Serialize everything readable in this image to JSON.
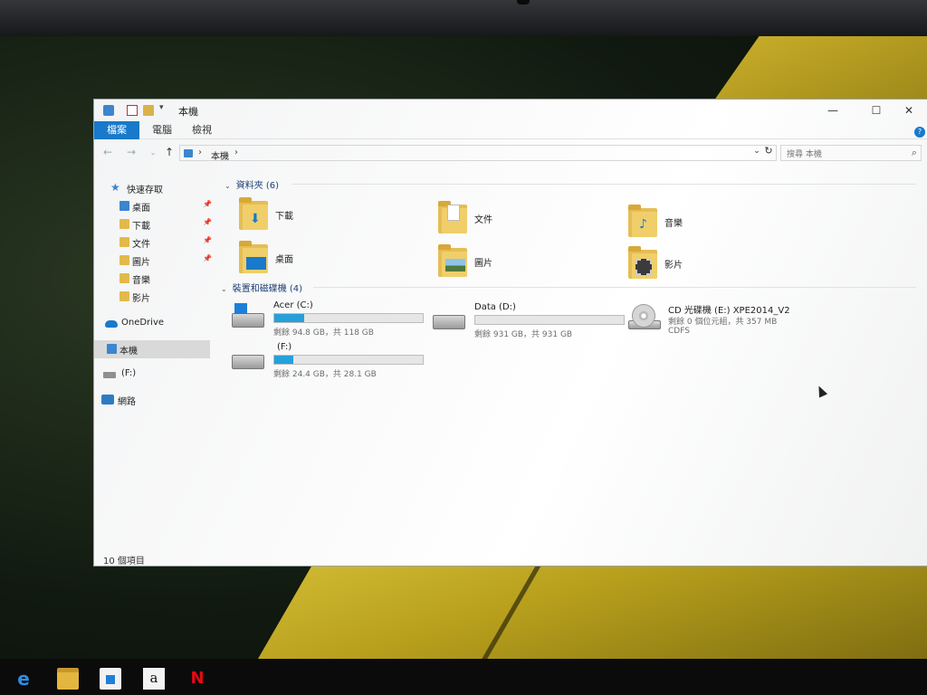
{
  "window": {
    "title": "本機",
    "ribbon_tabs": [
      "檔案",
      "電腦",
      "檢視"
    ],
    "minimize": "—",
    "maximize": "☐",
    "close": "✕"
  },
  "address_bar": {
    "path": "本機",
    "search_placeholder": "搜尋 本機"
  },
  "sidebar": {
    "quick_access": "快速存取",
    "quick_items": [
      {
        "label": "桌面",
        "pinned": true
      },
      {
        "label": "下載",
        "pinned": true
      },
      {
        "label": "文件",
        "pinned": true
      },
      {
        "label": "圖片",
        "pinned": true
      },
      {
        "label": "音樂",
        "pinned": false
      },
      {
        "label": "影片",
        "pinned": false
      }
    ],
    "onedrive": "OneDrive",
    "this_pc": "本機",
    "drive_f": "(F:)",
    "network": "網路"
  },
  "folders_group": {
    "heading": "資料夾 (6)",
    "items": [
      {
        "label": "下載",
        "icon": "download-arrow"
      },
      {
        "label": "文件",
        "icon": "document"
      },
      {
        "label": "音樂",
        "icon": "music-note"
      },
      {
        "label": "桌面",
        "icon": "desktop-screen"
      },
      {
        "label": "圖片",
        "icon": "picture"
      },
      {
        "label": "影片",
        "icon": "film-strip"
      }
    ]
  },
  "devices_group": {
    "heading": "裝置和磁碟機 (4)",
    "drives": [
      {
        "name": "Acer (C:)",
        "info": "剩餘 94.8 GB，共 118 GB",
        "used_fraction": 0.2,
        "system": true
      },
      {
        "name": "Data (D:)",
        "info": "剩餘 931 GB，共 931 GB",
        "used_fraction": 0.0,
        "system": false
      },
      {
        "name": "(F:)",
        "info": "剩餘 24.4 GB，共 28.1 GB",
        "used_fraction": 0.13,
        "system": false
      }
    ],
    "optical": {
      "name": "CD 光碟機 (E:) XPE2014_V2",
      "info": "剩餘 0 個位元組，共 357 MB",
      "fs": "CDFS"
    }
  },
  "status": {
    "items": "10 個項目"
  },
  "taskbar": {
    "edge": "e",
    "amazon": "a",
    "netflix": "N"
  },
  "colors": {
    "accent": "#1979ca",
    "bar_fill": "#26a0da",
    "group_heading": "#1e3f78"
  }
}
